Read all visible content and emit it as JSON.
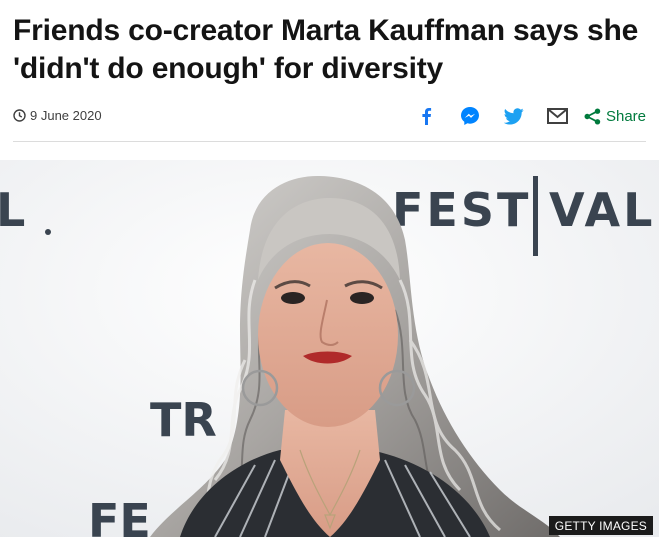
{
  "article": {
    "headline": "Friends co-creator Marta Kauffman says she 'didn't do enough' for diversity",
    "date": "9 June 2020",
    "share_label": "Share",
    "share_icons": [
      "facebook-icon",
      "messenger-icon",
      "twitter-icon",
      "email-icon",
      "share-icon"
    ]
  },
  "image": {
    "caption": "GETTY IMAGES",
    "backdrop_text_right": "FEST|VAL",
    "backdrop_text_left": "L.",
    "backdrop_text_mid": "TR",
    "backdrop_text_bottom": "FE"
  },
  "colors": {
    "headline": "#141414",
    "facebook": "#1877f2",
    "messenger": "#0084ff",
    "twitter": "#1da1f2",
    "email": "#404040",
    "share": "#007a3d"
  }
}
